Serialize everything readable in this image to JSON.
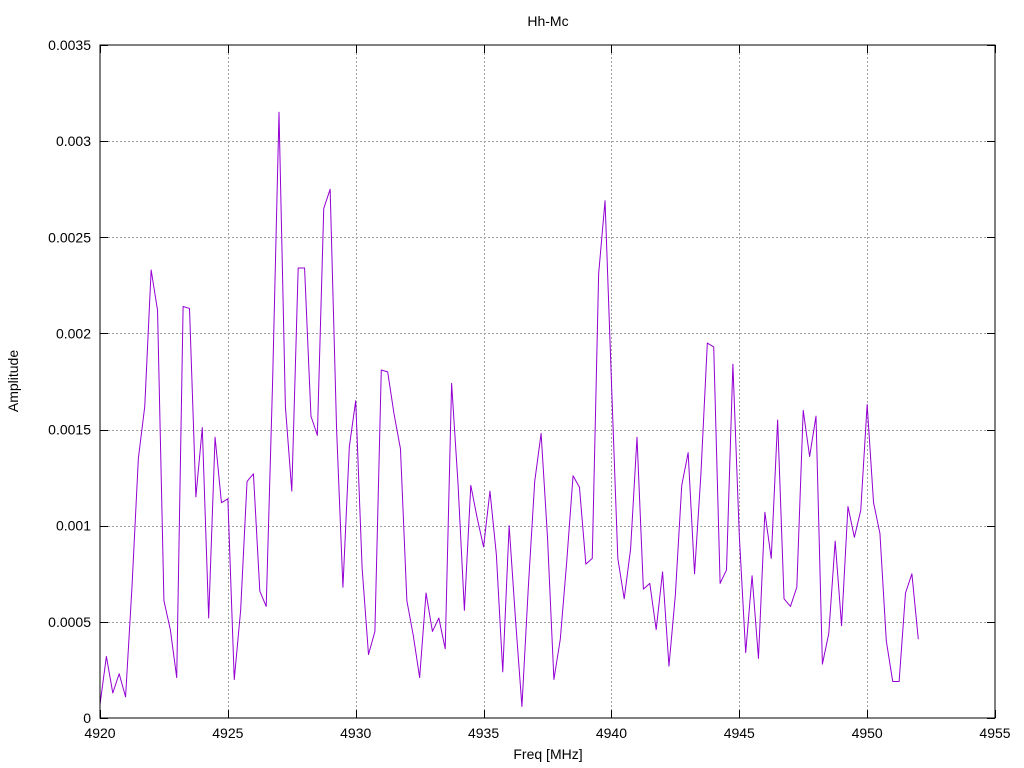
{
  "chart_data": {
    "type": "line",
    "title": "Hh-Mc",
    "xlabel": "Freq [MHz]",
    "ylabel": "Amplitude",
    "xlim": [
      4920,
      4955
    ],
    "ylim": [
      0,
      0.0035
    ],
    "xticks": [
      4920,
      4925,
      4930,
      4935,
      4940,
      4945,
      4950,
      4955
    ],
    "xtick_labels": [
      "4920",
      "4925",
      "4930",
      "4935",
      "4940",
      "4945",
      "4950",
      "4955"
    ],
    "yticks": [
      0,
      0.0005,
      0.001,
      0.0015,
      0.002,
      0.0025,
      0.003,
      0.0035
    ],
    "ytick_labels": [
      "0",
      "0.0005",
      "0.001",
      "0.0015",
      "0.002",
      "0.0025",
      "0.003",
      "0.0035"
    ],
    "grid": true,
    "series": [
      {
        "color": "#9400d3",
        "x": [
          4920.0,
          4920.25,
          4920.5,
          4920.75,
          4921.0,
          4921.25,
          4921.5,
          4921.75,
          4922.0,
          4922.25,
          4922.5,
          4922.75,
          4923.0,
          4923.25,
          4923.5,
          4923.75,
          4924.0,
          4924.25,
          4924.5,
          4924.75,
          4925.0,
          4925.25,
          4925.5,
          4925.75,
          4926.0,
          4926.25,
          4926.5,
          4926.75,
          4927.0,
          4927.25,
          4927.5,
          4927.75,
          4928.0,
          4928.25,
          4928.5,
          4928.75,
          4929.0,
          4929.25,
          4929.5,
          4929.75,
          4930.0,
          4930.25,
          4930.5,
          4930.75,
          4931.0,
          4931.25,
          4931.5,
          4931.75,
          4932.0,
          4932.25,
          4932.5,
          4932.75,
          4933.0,
          4933.25,
          4933.5,
          4933.75,
          4934.0,
          4934.25,
          4934.5,
          4934.75,
          4935.0,
          4935.25,
          4935.5,
          4935.75,
          4936.0,
          4936.25,
          4936.5,
          4936.75,
          4937.0,
          4937.25,
          4937.5,
          4937.75,
          4938.0,
          4938.25,
          4938.5,
          4938.75,
          4939.0,
          4939.25,
          4939.5,
          4939.75,
          4940.0,
          4940.25,
          4940.5,
          4940.75,
          4941.0,
          4941.25,
          4941.5,
          4941.75,
          4942.0,
          4942.25,
          4942.5,
          4942.75,
          4943.0,
          4943.25,
          4943.5,
          4943.75,
          4944.0,
          4944.25,
          4944.5,
          4944.75,
          4945.0,
          4945.25,
          4945.5,
          4945.75,
          4946.0,
          4946.25,
          4946.5,
          4946.75,
          4947.0,
          4947.25,
          4947.5,
          4947.75,
          4948.0,
          4948.25,
          4948.5,
          4948.75,
          4949.0,
          4949.25,
          4949.5,
          4949.75,
          4950.0,
          4950.25,
          4950.5,
          4950.75,
          4951.0,
          4951.25,
          4951.5,
          4951.75,
          4952.0
        ],
        "y": [
          7e-05,
          0.00032,
          0.00013,
          0.00023,
          0.00011,
          0.00068,
          0.00135,
          0.00162,
          0.00233,
          0.00212,
          0.00061,
          0.00046,
          0.00021,
          0.00214,
          0.00213,
          0.00115,
          0.00151,
          0.00052,
          0.00146,
          0.00112,
          0.00114,
          0.0002,
          0.00056,
          0.00123,
          0.00127,
          0.00066,
          0.00058,
          0.00175,
          0.00315,
          0.00162,
          0.00118,
          0.00234,
          0.00234,
          0.00157,
          0.00147,
          0.00265,
          0.00275,
          0.00151,
          0.00068,
          0.00141,
          0.00165,
          0.00078,
          0.00033,
          0.00045,
          0.00181,
          0.0018,
          0.00158,
          0.0014,
          0.00061,
          0.00043,
          0.00021,
          0.00065,
          0.00045,
          0.00052,
          0.00036,
          0.00174,
          0.00122,
          0.00056,
          0.00121,
          0.00104,
          0.00089,
          0.00118,
          0.00085,
          0.00024,
          0.001,
          0.00051,
          6e-05,
          0.00068,
          0.00123,
          0.00148,
          0.00094,
          0.0002,
          0.00041,
          0.00081,
          0.00126,
          0.0012,
          0.0008,
          0.00083,
          0.00231,
          0.00269,
          0.00175,
          0.00083,
          0.00062,
          0.00088,
          0.00146,
          0.00067,
          0.0007,
          0.00046,
          0.00076,
          0.00027,
          0.00064,
          0.00121,
          0.00138,
          0.00075,
          0.00127,
          0.00195,
          0.00193,
          0.0007,
          0.00077,
          0.00184,
          0.00095,
          0.00034,
          0.00074,
          0.00031,
          0.00107,
          0.00083,
          0.00155,
          0.00062,
          0.00058,
          0.00068,
          0.0016,
          0.00136,
          0.00157,
          0.00028,
          0.00044,
          0.00092,
          0.00048,
          0.0011,
          0.00094,
          0.00108,
          0.00163,
          0.00112,
          0.00096,
          0.0004,
          0.00019,
          0.00019,
          0.00065,
          0.00075,
          0.00041
        ]
      }
    ]
  }
}
